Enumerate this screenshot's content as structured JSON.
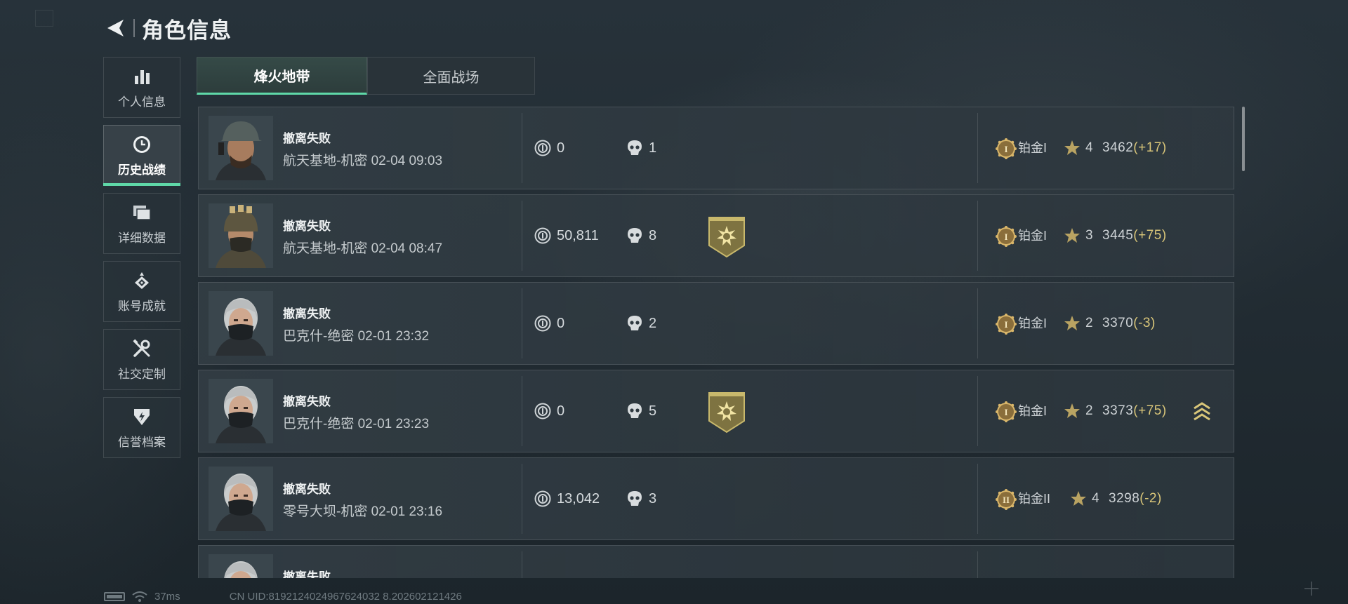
{
  "header": {
    "title": "角色信息"
  },
  "sidebar": {
    "items": [
      {
        "label": "个人信息",
        "icon": "bar-chart-icon"
      },
      {
        "label": "历史战绩",
        "icon": "clock-icon",
        "active": true
      },
      {
        "label": "详细数据",
        "icon": "folders-icon"
      },
      {
        "label": "账号成就",
        "icon": "achievement-icon"
      },
      {
        "label": "社交定制",
        "icon": "tools-icon"
      },
      {
        "label": "信誉档案",
        "icon": "shield-icon"
      }
    ]
  },
  "tabs": [
    {
      "label": "烽火地带",
      "active": true
    },
    {
      "label": "全面战场",
      "active": false
    }
  ],
  "matches": [
    {
      "result": "撤离失败",
      "map": "航天基地-机密",
      "time": "02-04 09:03",
      "coins": "0",
      "kills": "1",
      "medal": false,
      "rank_tier": "I",
      "rank": "铂金I",
      "stars": "4",
      "score": "3462",
      "delta": "(+17)",
      "promo": false,
      "avatar": "cap-operator"
    },
    {
      "result": "撤离失败",
      "map": "航天基地-机密",
      "time": "02-04 08:47",
      "coins": "50,811",
      "kills": "8",
      "medal": true,
      "rank_tier": "I",
      "rank": "铂金I",
      "stars": "3",
      "score": "3445",
      "delta": "(+75)",
      "promo": false,
      "avatar": "helmet-operator"
    },
    {
      "result": "撤离失败",
      "map": "巴克什-绝密",
      "time": "02-01 23:32",
      "coins": "0",
      "kills": "2",
      "medal": false,
      "rank_tier": "I",
      "rank": "铂金I",
      "stars": "2",
      "score": "3370",
      "delta": "(-3)",
      "promo": false,
      "avatar": "masked-operator"
    },
    {
      "result": "撤离失败",
      "map": "巴克什-绝密",
      "time": "02-01 23:23",
      "coins": "0",
      "kills": "5",
      "medal": true,
      "rank_tier": "I",
      "rank": "铂金I",
      "stars": "2",
      "score": "3373",
      "delta": "(+75)",
      "promo": true,
      "avatar": "masked-operator"
    },
    {
      "result": "撤离失败",
      "map": "零号大坝-机密",
      "time": "02-01 23:16",
      "coins": "13,042",
      "kills": "3",
      "medal": false,
      "rank_tier": "II",
      "rank": "铂金II",
      "stars": "4",
      "score": "3298",
      "delta": "(-2)",
      "promo": false,
      "avatar": "masked-operator"
    },
    {
      "result": "撤离失败",
      "map": "",
      "time": "",
      "coins": "",
      "kills": "",
      "medal": false,
      "rank_tier": "",
      "rank": "",
      "stars": "",
      "score": "",
      "delta": "",
      "promo": false,
      "avatar": "masked-operator"
    }
  ],
  "status": {
    "ping": "37ms",
    "uid": "CN UID:8192124024967624032 8.202602121426"
  },
  "colors": {
    "accent": "#5fd8a8",
    "gold": "#d9c679",
    "panel": "#2e383f"
  }
}
